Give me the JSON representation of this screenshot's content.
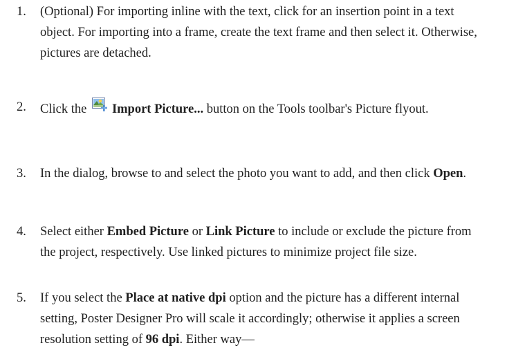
{
  "steps": [
    {
      "number": "1.",
      "parts": [
        {
          "t": "(Optional) For importing inline with the text, click for an insertion point in a text object. For importing into a frame, create the text frame and then select it. Otherwise, pictures are detached.",
          "b": false
        }
      ]
    },
    {
      "number": "2.",
      "parts": [
        {
          "t": "Click the ",
          "b": false
        },
        {
          "icon": "import-picture-icon"
        },
        {
          "t": "Import Picture...",
          "b": true
        },
        {
          "t": " button on the Tools toolbar's Picture flyout.",
          "b": false
        }
      ]
    },
    {
      "number": "3.",
      "parts": [
        {
          "t": "In the dialog, browse to and select the photo you want to add, and then click ",
          "b": false
        },
        {
          "t": "Open",
          "b": true
        },
        {
          "t": ".",
          "b": false
        }
      ]
    },
    {
      "number": "4.",
      "parts": [
        {
          "t": "Select either ",
          "b": false
        },
        {
          "t": "Embed Picture",
          "b": true
        },
        {
          "t": " or ",
          "b": false
        },
        {
          "t": "Link Picture",
          "b": true
        },
        {
          "t": " to include or exclude the picture from the project, respectively. Use linked pictures to minimize project file size.",
          "b": false
        }
      ]
    },
    {
      "number": "5.",
      "parts": [
        {
          "t": "If you select the ",
          "b": false
        },
        {
          "t": "Place at native dpi",
          "b": true
        },
        {
          "t": " option and the picture has a different internal setting, Poster Designer Pro will scale it accordingly; otherwise it applies a screen resolution setting of ",
          "b": false
        },
        {
          "t": "96 dpi",
          "b": true
        },
        {
          "t": ". Either way—",
          "b": false
        }
      ]
    }
  ]
}
